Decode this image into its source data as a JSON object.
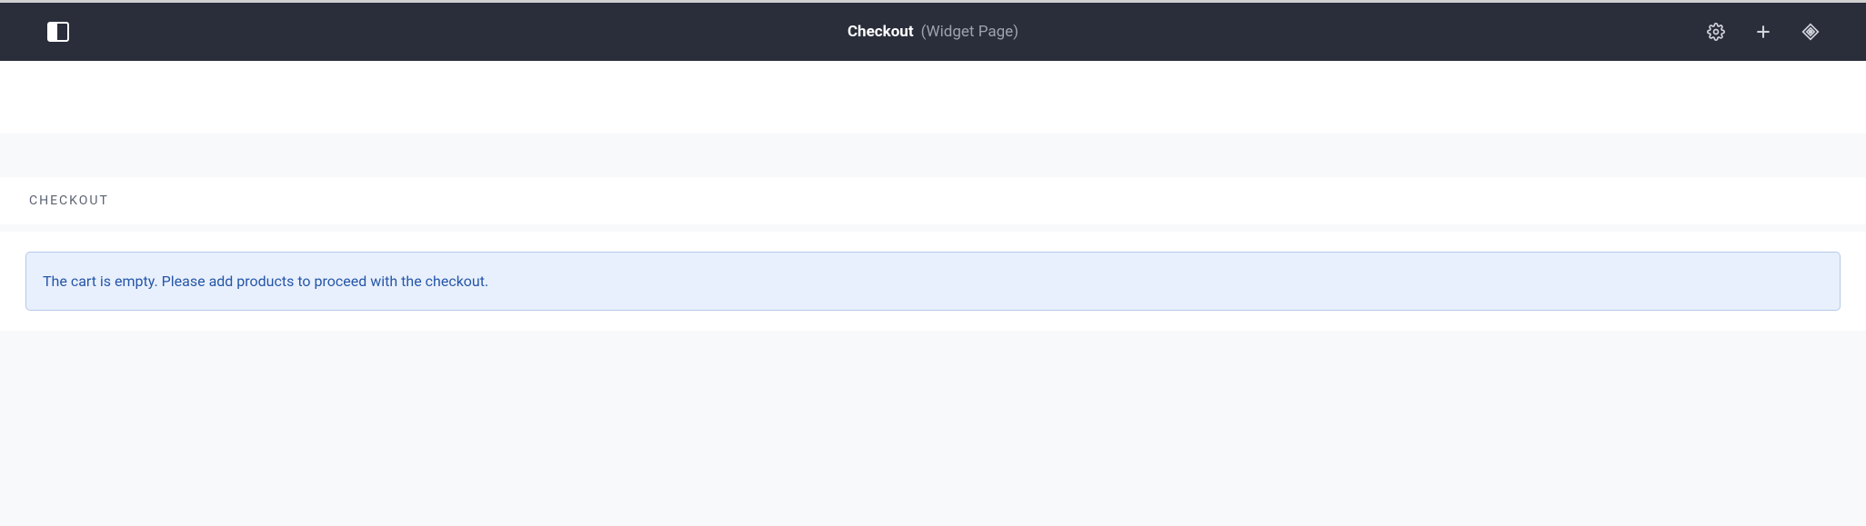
{
  "header": {
    "title": "Checkout",
    "subtitle": "(Widget Page)"
  },
  "main": {
    "section_label": "CHECKOUT",
    "empty_cart_message": "The cart is empty. Please add products to proceed with the checkout."
  }
}
